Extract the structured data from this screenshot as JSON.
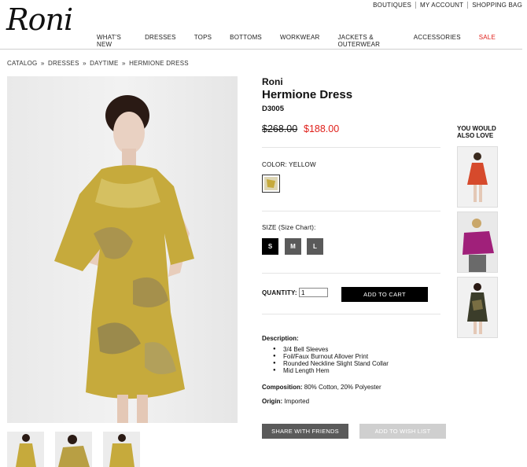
{
  "utility_nav": {
    "boutiques": "BOUTIQUES",
    "account": "MY ACCOUNT",
    "bag": "SHOPPING BAG"
  },
  "logo": "Roni",
  "nav": {
    "items": [
      "WHAT'S NEW",
      "DRESSES",
      "TOPS",
      "BOTTOMS",
      "WORKWEAR",
      "JACKETS & OUTERWEAR",
      "ACCESSORIES",
      "SALE"
    ]
  },
  "breadcrumb": [
    "CATALOG",
    "DRESSES",
    "DAYTIME",
    "HERMIONE DRESS"
  ],
  "breadcrumb_sep": "»",
  "product": {
    "brand": "Roni",
    "name": "Hermione Dress",
    "sku": "D3005",
    "price_old": "$268.00",
    "price_new": "$188.00",
    "color_label": "COLOR:",
    "color_value": "YELLOW",
    "size_label": "SIZE",
    "size_chart": "(Size Chart):",
    "sizes": [
      "S",
      "M",
      "L"
    ],
    "quantity_label": "QUANTITY:",
    "quantity_value": "1",
    "add_to_cart": "ADD TO CART",
    "description_label": "Description:",
    "description_items": [
      "3/4 Bell Sleeves",
      "Foil/Faux Burnout Allover Print",
      "Rounded Neckline Slight Stand Collar",
      "Mid Length Hem"
    ],
    "composition_label": "Composition:",
    "composition_value": "80% Cotton, 20% Polyester",
    "origin_label": "Origin:",
    "origin_value": "Imported",
    "share": "SHARE WITH FRIENDS",
    "wishlist": "ADD TO WISH LIST"
  },
  "also_love": {
    "title_line1": "YOU WOULD",
    "title_line2": "ALSO LOVE"
  },
  "colors": {
    "sale": "#e0201b",
    "price_new": "#e0201b",
    "dress": "#c6aa3c",
    "button_dark": "#000000",
    "button_mid": "#5a5a5a",
    "button_disabled": "#cfcfcf"
  }
}
